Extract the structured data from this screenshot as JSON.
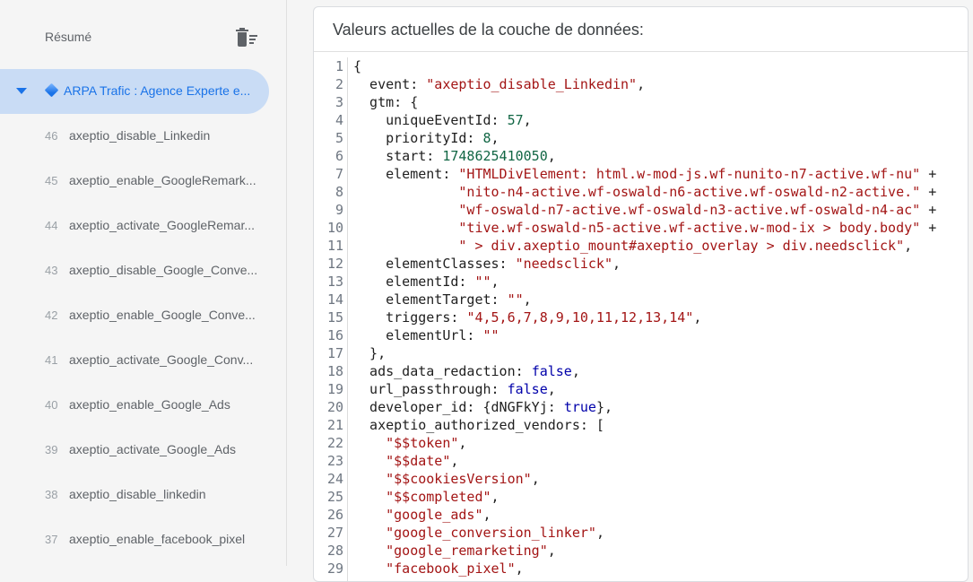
{
  "sidebar": {
    "summary_label": "Résumé",
    "clear_icon": "delete-sweep-icon",
    "container": {
      "icon": "diamond-icon",
      "label": "ARPA Trafic : Agence Experte e..."
    },
    "events": [
      {
        "num": "46",
        "label": "axeptio_disable_Linkedin"
      },
      {
        "num": "45",
        "label": "axeptio_enable_GoogleRemark..."
      },
      {
        "num": "44",
        "label": "axeptio_activate_GoogleRemar..."
      },
      {
        "num": "43",
        "label": "axeptio_disable_Google_Conve..."
      },
      {
        "num": "42",
        "label": "axeptio_enable_Google_Conve..."
      },
      {
        "num": "41",
        "label": "axeptio_activate_Google_Conv..."
      },
      {
        "num": "40",
        "label": "axeptio_enable_Google_Ads"
      },
      {
        "num": "39",
        "label": "axeptio_activate_Google_Ads"
      },
      {
        "num": "38",
        "label": "axeptio_disable_linkedin"
      },
      {
        "num": "37",
        "label": "axeptio_enable_facebook_pixel"
      }
    ]
  },
  "main": {
    "title": "Valeurs actuelles de la couche de données:",
    "code_lines": [
      [
        {
          "t": "{",
          "c": "p"
        }
      ],
      [
        {
          "t": "  event: ",
          "c": "p"
        },
        {
          "t": "\"axeptio_disable_Linkedin\"",
          "c": "s"
        },
        {
          "t": ",",
          "c": "p"
        }
      ],
      [
        {
          "t": "  gtm: {",
          "c": "p"
        }
      ],
      [
        {
          "t": "    uniqueEventId: ",
          "c": "p"
        },
        {
          "t": "57",
          "c": "n"
        },
        {
          "t": ",",
          "c": "p"
        }
      ],
      [
        {
          "t": "    priorityId: ",
          "c": "p"
        },
        {
          "t": "8",
          "c": "n"
        },
        {
          "t": ",",
          "c": "p"
        }
      ],
      [
        {
          "t": "    start: ",
          "c": "p"
        },
        {
          "t": "1748625410050",
          "c": "n"
        },
        {
          "t": ",",
          "c": "p"
        }
      ],
      [
        {
          "t": "    element: ",
          "c": "p"
        },
        {
          "t": "\"HTMLDivElement: html.w-mod-js.wf-nunito-n7-active.wf-nu\"",
          "c": "s"
        },
        {
          "t": " +",
          "c": "p"
        }
      ],
      [
        {
          "t": "             ",
          "c": "p"
        },
        {
          "t": "\"nito-n4-active.wf-oswald-n6-active.wf-oswald-n2-active.\"",
          "c": "s"
        },
        {
          "t": " +",
          "c": "p"
        }
      ],
      [
        {
          "t": "             ",
          "c": "p"
        },
        {
          "t": "\"wf-oswald-n7-active.wf-oswald-n3-active.wf-oswald-n4-ac\"",
          "c": "s"
        },
        {
          "t": " +",
          "c": "p"
        }
      ],
      [
        {
          "t": "             ",
          "c": "p"
        },
        {
          "t": "\"tive.wf-oswald-n5-active.wf-active.w-mod-ix > body.body\"",
          "c": "s"
        },
        {
          "t": " +",
          "c": "p"
        }
      ],
      [
        {
          "t": "             ",
          "c": "p"
        },
        {
          "t": "\" > div.axeptio_mount#axeptio_overlay > div.needsclick\"",
          "c": "s"
        },
        {
          "t": ",",
          "c": "p"
        }
      ],
      [
        {
          "t": "    elementClasses: ",
          "c": "p"
        },
        {
          "t": "\"needsclick\"",
          "c": "s"
        },
        {
          "t": ",",
          "c": "p"
        }
      ],
      [
        {
          "t": "    elementId: ",
          "c": "p"
        },
        {
          "t": "\"\"",
          "c": "s"
        },
        {
          "t": ",",
          "c": "p"
        }
      ],
      [
        {
          "t": "    elementTarget: ",
          "c": "p"
        },
        {
          "t": "\"\"",
          "c": "s"
        },
        {
          "t": ",",
          "c": "p"
        }
      ],
      [
        {
          "t": "    triggers: ",
          "c": "p"
        },
        {
          "t": "\"4,5,6,7,8,9,10,11,12,13,14\"",
          "c": "s"
        },
        {
          "t": ",",
          "c": "p"
        }
      ],
      [
        {
          "t": "    elementUrl: ",
          "c": "p"
        },
        {
          "t": "\"\"",
          "c": "s"
        }
      ],
      [
        {
          "t": "  },",
          "c": "p"
        }
      ],
      [
        {
          "t": "  ads_data_redaction: ",
          "c": "p"
        },
        {
          "t": "false",
          "c": "k"
        },
        {
          "t": ",",
          "c": "p"
        }
      ],
      [
        {
          "t": "  url_passthrough: ",
          "c": "p"
        },
        {
          "t": "false",
          "c": "k"
        },
        {
          "t": ",",
          "c": "p"
        }
      ],
      [
        {
          "t": "  developer_id: {dNGFkYj: ",
          "c": "p"
        },
        {
          "t": "true",
          "c": "k"
        },
        {
          "t": "},",
          "c": "p"
        }
      ],
      [
        {
          "t": "  axeptio_authorized_vendors: [",
          "c": "p"
        }
      ],
      [
        {
          "t": "    ",
          "c": "p"
        },
        {
          "t": "\"$$token\"",
          "c": "s"
        },
        {
          "t": ",",
          "c": "p"
        }
      ],
      [
        {
          "t": "    ",
          "c": "p"
        },
        {
          "t": "\"$$date\"",
          "c": "s"
        },
        {
          "t": ",",
          "c": "p"
        }
      ],
      [
        {
          "t": "    ",
          "c": "p"
        },
        {
          "t": "\"$$cookiesVersion\"",
          "c": "s"
        },
        {
          "t": ",",
          "c": "p"
        }
      ],
      [
        {
          "t": "    ",
          "c": "p"
        },
        {
          "t": "\"$$completed\"",
          "c": "s"
        },
        {
          "t": ",",
          "c": "p"
        }
      ],
      [
        {
          "t": "    ",
          "c": "p"
        },
        {
          "t": "\"google_ads\"",
          "c": "s"
        },
        {
          "t": ",",
          "c": "p"
        }
      ],
      [
        {
          "t": "    ",
          "c": "p"
        },
        {
          "t": "\"google_conversion_linker\"",
          "c": "s"
        },
        {
          "t": ",",
          "c": "p"
        }
      ],
      [
        {
          "t": "    ",
          "c": "p"
        },
        {
          "t": "\"google_remarketing\"",
          "c": "s"
        },
        {
          "t": ",",
          "c": "p"
        }
      ],
      [
        {
          "t": "    ",
          "c": "p"
        },
        {
          "t": "\"facebook_pixel\"",
          "c": "s"
        },
        {
          "t": ",",
          "c": "p"
        }
      ]
    ]
  },
  "colors": {
    "accent": "#1a73e8",
    "selected_bg": "#c9dcf5",
    "string": "#a31515",
    "number": "#116644",
    "keyword": "#0000aa"
  }
}
